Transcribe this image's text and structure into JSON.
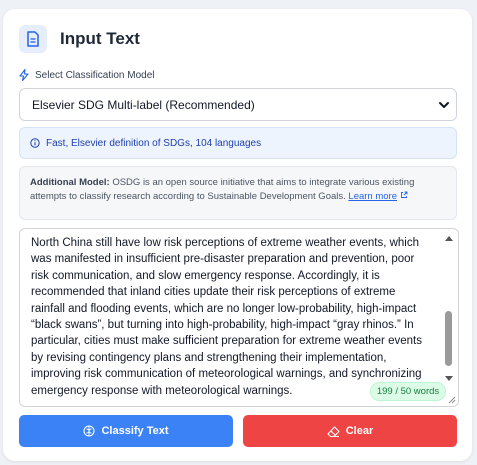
{
  "header": {
    "title": "Input Text"
  },
  "model": {
    "label": "Select Classification Model",
    "selected": "Elsevier SDG Multi-label (Recommended)"
  },
  "info": {
    "text": "Fast, Elsevier definition of SDGs, 104 languages"
  },
  "additional": {
    "label": "Additional Model:",
    "text": " OSDG is an open source initiative that aims to integrate various existing attempts to classify research according to Sustainable Development Goals. ",
    "link": "Learn more"
  },
  "input": {
    "text": "North China still have low risk perceptions of extreme weather events, which was manifested in insufficient pre-disaster preparation and prevention, poor risk communication, and slow emergency response. Accordingly, it is recommended that inland cities update their risk perceptions of extreme rainfall and flooding events, which are no longer low-probability, high-impact “black swans”, but turning into high-probability, high-impact “gray rhinos.” In particular, cities must make sufficient preparation for extreme weather events by revising contingency plans and strengthening their implementation, improving risk communication of meteorological warnings, and synchronizing emergency response with meteorological warnings.",
    "word_count": "199 / 50 words"
  },
  "buttons": {
    "classify": "Classify Text",
    "clear": "Clear"
  },
  "colors": {
    "primary": "#3b82f6",
    "danger": "#ef4444",
    "success_bg": "#dcfce7",
    "success_text": "#15803d"
  }
}
